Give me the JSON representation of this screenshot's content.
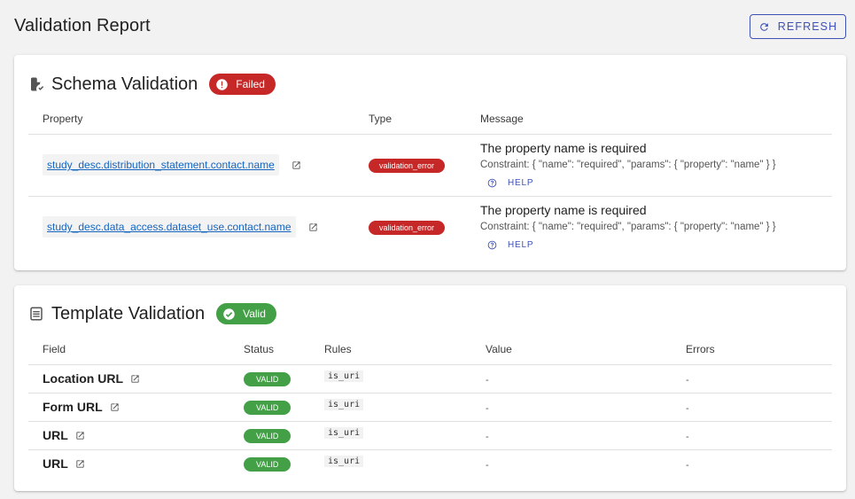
{
  "page": {
    "title": "Validation Report"
  },
  "toolbar": {
    "refresh_label": "REFRESH"
  },
  "schema": {
    "title": "Schema Validation",
    "status": "Failed",
    "columns": [
      "Property",
      "Type",
      "Message"
    ],
    "rows": [
      {
        "property": "study_desc.distribution_statement.contact.name",
        "type": "validation_error",
        "message": "The property name is required",
        "constraint": "Constraint: { \"name\": \"required\", \"params\": { \"property\": \"name\" } }",
        "help": "HELP"
      },
      {
        "property": "study_desc.data_access.dataset_use.contact.name",
        "type": "validation_error",
        "message": "The property name is required",
        "constraint": "Constraint: { \"name\": \"required\", \"params\": { \"property\": \"name\" } }",
        "help": "HELP"
      }
    ]
  },
  "template": {
    "title": "Template Validation",
    "status": "Valid",
    "columns": [
      "Field",
      "Status",
      "Rules",
      "Value",
      "Errors"
    ],
    "rows": [
      {
        "field": "Location URL",
        "status": "VALID",
        "rules": "is_uri",
        "value": "-",
        "errors": "-"
      },
      {
        "field": "Form URL",
        "status": "VALID",
        "rules": "is_uri",
        "value": "-",
        "errors": "-"
      },
      {
        "field": "URL",
        "status": "VALID",
        "rules": "is_uri",
        "value": "-",
        "errors": "-"
      },
      {
        "field": "URL",
        "status": "VALID",
        "rules": "is_uri",
        "value": "-",
        "errors": "-"
      }
    ]
  },
  "colors": {
    "accent": "#3f51b5",
    "error": "#c62828",
    "success": "#43a047",
    "link": "#1565c0"
  },
  "icons": {
    "refresh": "refresh-icon",
    "schema": "file-check-icon",
    "template": "list-document-icon",
    "failed": "error-circle-icon",
    "valid": "check-circle-icon",
    "open": "open-in-new-icon",
    "help": "help-circle-icon"
  }
}
